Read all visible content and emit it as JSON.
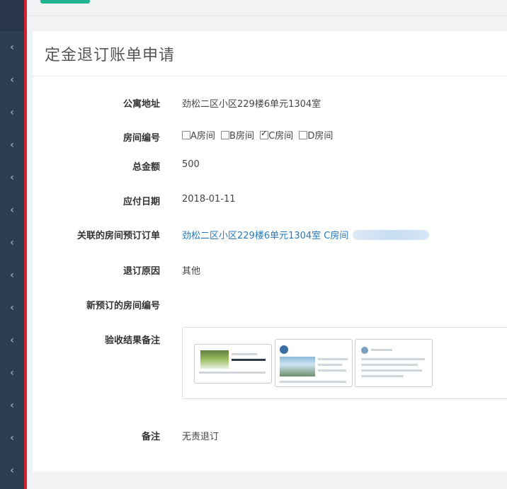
{
  "page": {
    "title": "定金退订账单申请"
  },
  "fields": {
    "address": {
      "label": "公寓地址",
      "value": "劲松二区小区229楼6单元1304室"
    },
    "rooms": {
      "label": "房间编号",
      "options": [
        {
          "label": "A房间",
          "checked": false
        },
        {
          "label": "B房间",
          "checked": false
        },
        {
          "label": "C房间",
          "checked": true
        },
        {
          "label": "D房间",
          "checked": false
        }
      ]
    },
    "total": {
      "label": "总金额",
      "value": "500"
    },
    "due_date": {
      "label": "应付日期",
      "value": "2018-01-11"
    },
    "linked_order": {
      "label": "关联的房间预订订单",
      "value": "劲松二区小区229楼6单元1304室 C房间"
    },
    "reason": {
      "label": "退订原因",
      "value": "其他"
    },
    "new_room": {
      "label": "新预订的房间编号",
      "value": ""
    },
    "inspection": {
      "label": "验收结果备注"
    },
    "notes": {
      "label": "备注",
      "value": "无责退订"
    }
  },
  "colors": {
    "sidebar": "#2b3d51",
    "sidebar_border": "#d7222b",
    "accent_button": "#1fb591",
    "link": "#2a78b8"
  },
  "icons": {
    "sidebar_item": "chevron-left-icon"
  }
}
